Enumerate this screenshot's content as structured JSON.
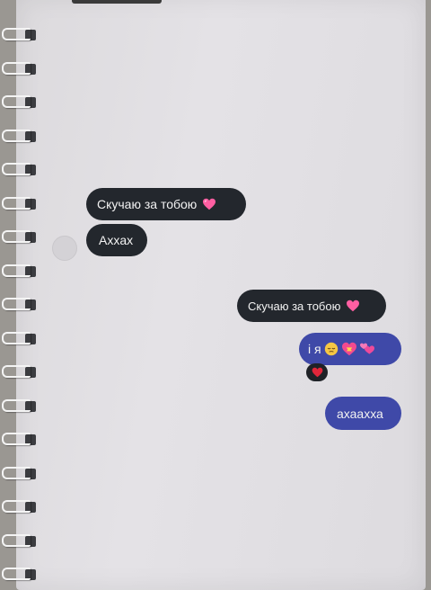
{
  "conversation": {
    "messages": [
      {
        "text": "Скучаю за тобою",
        "icon": "pink-heart-icon",
        "side": "incoming"
      },
      {
        "text": "Ахxax",
        "side": "incoming"
      },
      {
        "text": "Скучаю за тобою",
        "icon": "pink-heart-icon",
        "side": "outgoing"
      },
      {
        "text": "і я",
        "icons": [
          "pensive-face-icon",
          "heart-with-ribbon-icon",
          "two-hearts-icon"
        ],
        "side": "outgoing",
        "reaction": "red-heart-icon"
      },
      {
        "text": "ахаахха",
        "side": "outgoing"
      }
    ]
  },
  "colors": {
    "dark_bubble": "#23272d",
    "blue_bubble": "#3f49a8",
    "heart_pink": "#ff5fa2",
    "reaction_red": "#e0263a"
  }
}
